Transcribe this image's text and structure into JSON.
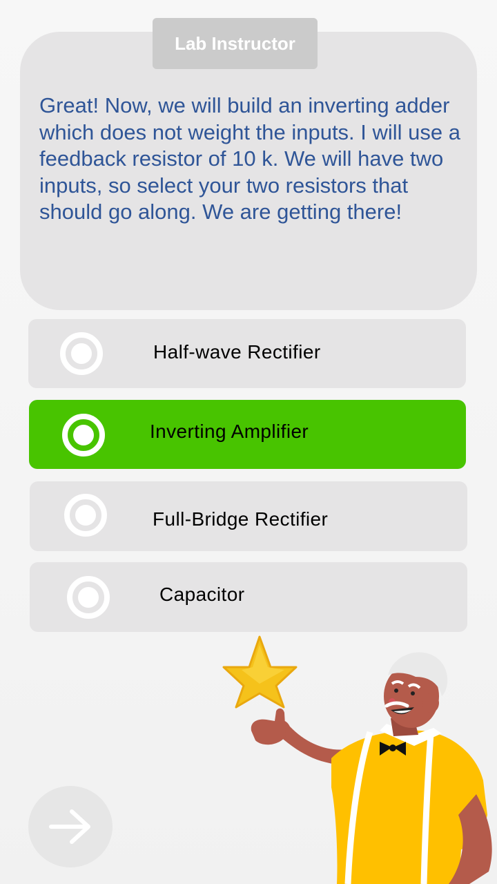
{
  "speaker": {
    "label": "Lab Instructor"
  },
  "message": {
    "text": "Great! Now, we will build an inverting adder which does not weight the inputs. I will use a feedback resistor of 10 k. We will have two inputs, so select your two resistors that should go along. We are getting there!"
  },
  "options": [
    {
      "label": "Half-wave Rectifier",
      "selected": false
    },
    {
      "label": "Inverting Amplifier",
      "selected": true
    },
    {
      "label": "Full-Bridge Rectifier",
      "selected": false
    },
    {
      "label": "Capacitor",
      "selected": false
    }
  ],
  "navigation": {
    "next_icon": "arrow-right-icon"
  },
  "colors": {
    "message_text": "#2f5597",
    "selected_option": "#48c400",
    "option_background": "#e5e4e5",
    "bubble_background": "#e5e4e5",
    "speaker_tag": "#cbcbcb"
  },
  "illustration": {
    "icons": [
      "star-icon",
      "instructor-character"
    ]
  }
}
